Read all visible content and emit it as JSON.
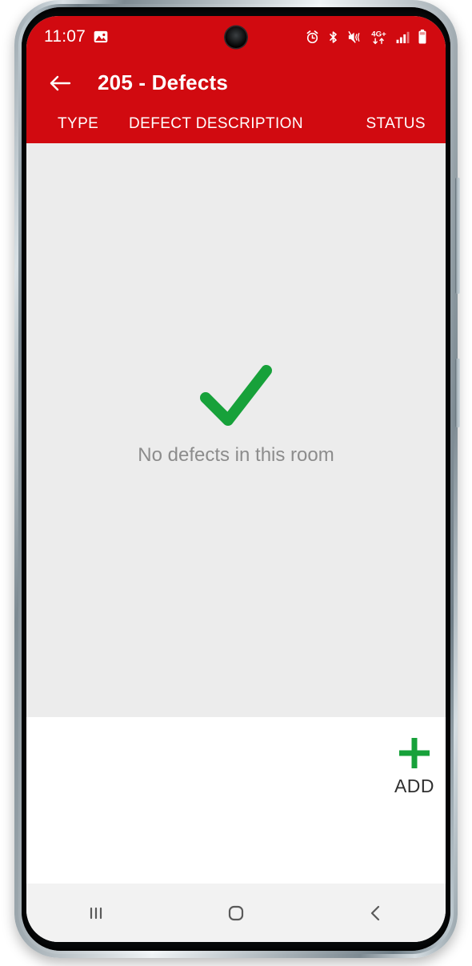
{
  "status_bar": {
    "time": "11:07",
    "left_icons": [
      {
        "name": "image-icon",
        "label": "Gallery notification"
      }
    ],
    "right_icons": [
      {
        "name": "alarm-icon",
        "label": "Alarm set"
      },
      {
        "name": "bluetooth-icon",
        "label": "Bluetooth on"
      },
      {
        "name": "vibrate-mute-icon",
        "label": "Sound muted / vibrate"
      },
      {
        "name": "network-4g-plus-icon",
        "label": "4G+"
      },
      {
        "name": "signal-bars-icon",
        "label": "Signal strength"
      },
      {
        "name": "battery-icon",
        "label": "Battery"
      }
    ],
    "network_label": "4G+",
    "background_color": "#d10a10",
    "foreground_color": "#ffffff"
  },
  "app_bar": {
    "back_label": "Back",
    "title": "205 - Defects",
    "background_color": "#d10a10"
  },
  "table": {
    "columns": [
      {
        "key": "type",
        "label": "TYPE"
      },
      {
        "key": "description",
        "label": "DEFECT DESCRIPTION"
      },
      {
        "key": "status",
        "label": "STATUS"
      }
    ],
    "rows": []
  },
  "empty_state": {
    "icon": "check-icon",
    "message": "No defects in this room",
    "icon_color": "#17a13a",
    "text_color": "#8c8c8c"
  },
  "footer": {
    "add": {
      "icon": "plus-icon",
      "label": "ADD",
      "icon_color": "#17a13a"
    }
  },
  "nav_bar": {
    "buttons": [
      {
        "name": "recents-button",
        "label": "Recents"
      },
      {
        "name": "home-button",
        "label": "Home"
      },
      {
        "name": "back-button",
        "label": "Back"
      }
    ]
  },
  "device": {
    "volume_button_label": "Volume",
    "power_button_label": "Power",
    "camera_label": "Front camera"
  }
}
